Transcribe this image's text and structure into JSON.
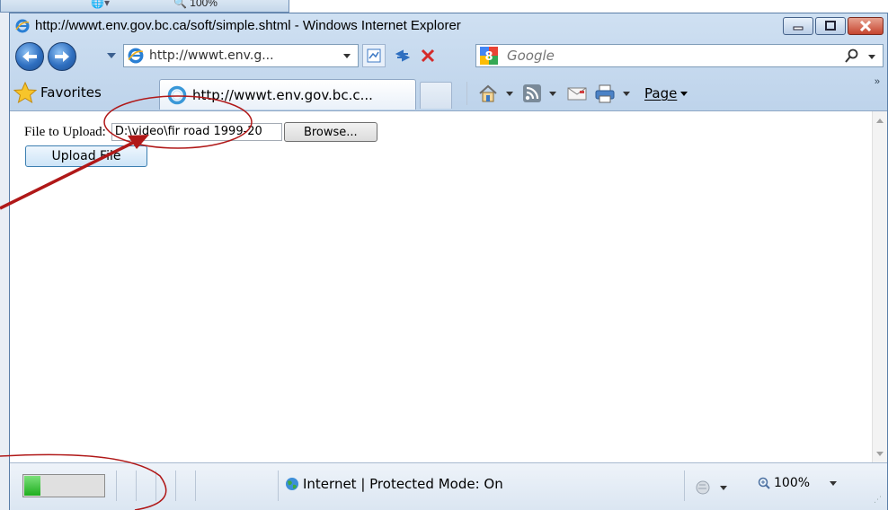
{
  "background_window": {
    "zoom_text": "100%"
  },
  "window": {
    "title": "http://wwwt.env.gov.bc.ca/soft/simple.shtml - Windows Internet Explorer"
  },
  "address_bar": {
    "value": "http://wwwt.env.g..."
  },
  "search": {
    "provider": "Google",
    "placeholder": "Google"
  },
  "tabs": {
    "favorites_label": "Favorites",
    "active_tab_label": "http://wwwt.env.gov.bc.c..."
  },
  "command_bar": {
    "page_label": "Page"
  },
  "form": {
    "file_label": "File to Upload:",
    "file_value": "D:\\video\\fir road 1999-20",
    "browse_label": "Browse...",
    "upload_label": "Upload File"
  },
  "status_bar": {
    "progress_fraction": 0.2,
    "zone_text": "Internet | Protected Mode: On",
    "zoom_text": "100%"
  },
  "colors": {
    "annotation": "#b01818",
    "accent": "#2f6fc0",
    "progress": "#1fae1f"
  },
  "icons": [
    "ie-logo-icon",
    "back-icon",
    "forward-icon",
    "refresh-icon",
    "stop-icon",
    "google-icon",
    "search-icon",
    "star-icon",
    "loading-icon",
    "home-icon",
    "feeds-icon",
    "mail-icon",
    "print-icon",
    "globe-icon",
    "zoom-icon",
    "minimize-icon",
    "maximize-icon",
    "close-icon"
  ]
}
